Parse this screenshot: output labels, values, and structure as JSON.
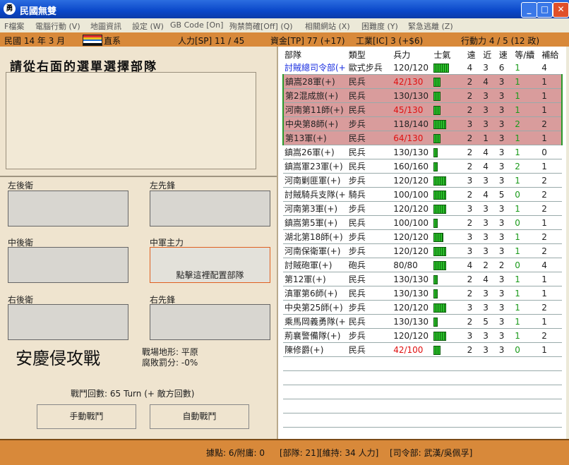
{
  "window": {
    "title": "民國無雙",
    "app_icon": "勇",
    "controls": {
      "minimize": "_",
      "maximize": "□",
      "close": "✕"
    }
  },
  "menu": [
    "F檔案",
    "電腦行動 (V)",
    "地圖資訊",
    "設定 (W)",
    "GB Code [On]",
    "殉禁筒確[Off] (Q)",
    "相關網站 (X)",
    "困難度 (Y)",
    "緊急逃離 (Z)"
  ],
  "status": {
    "date": "民國 14 年 3 月",
    "faction": "直系",
    "manpower": "人力[SP] 11 / 45",
    "money": "資金[TP] 77 (+17)",
    "industry": "工業[IC] 3 (+$6)",
    "action": "行動力 4 / 5 (12 政)",
    "flag_colors": [
      "#e03030",
      "#e8c020",
      "#2070d0",
      "#ffffff",
      "#101010"
    ]
  },
  "left": {
    "header": "請從右面的選單選擇部隊",
    "slots": {
      "left_rear": "左後衛",
      "left_front": "左先鋒",
      "center_rear": "中後衛",
      "center_main": "中軍主力",
      "center_main_hint": "點擊這裡配置部隊",
      "right_rear": "右後衛",
      "right_front": "右先鋒"
    },
    "battle_name": "安慶侵攻戰",
    "terrain": "戰場地形: 平原",
    "penalty": "腐敗罰分: -0%",
    "rounds": "戰鬥回數: 65 Turn (+ 敵方回數)",
    "manual_button": "手動戰鬥",
    "auto_button": "自動戰鬥"
  },
  "table": {
    "headers": [
      "部隊",
      "類型",
      "兵力",
      "士氣",
      "遠",
      "近",
      "速",
      "等/續",
      "補給"
    ],
    "rows": [
      {
        "name": "討賊總司令部(+",
        "type": "歐式步兵",
        "strength": "120/120",
        "morale_bars": 5,
        "far": "4",
        "near": "3",
        "speed": "6",
        "level": "1",
        "supply": "4",
        "hl": false,
        "blue": true,
        "red_strength": false
      },
      {
        "name": "鎮嵩28軍(+)",
        "type": "民兵",
        "strength": "42/130",
        "morale_bars": 2,
        "far": "2",
        "near": "4",
        "speed": "3",
        "level": "1",
        "supply": "1",
        "hl": true,
        "blue": false,
        "red_strength": true
      },
      {
        "name": "第2混成旅(+)",
        "type": "民兵",
        "strength": "130/130",
        "morale_bars": 2,
        "far": "2",
        "near": "3",
        "speed": "3",
        "level": "1",
        "supply": "1",
        "hl": true,
        "blue": false,
        "red_strength": false
      },
      {
        "name": "河南第11師(+)",
        "type": "民兵",
        "strength": "45/130",
        "morale_bars": 2,
        "far": "2",
        "near": "3",
        "speed": "3",
        "level": "1",
        "supply": "1",
        "hl": true,
        "blue": false,
        "red_strength": true
      },
      {
        "name": "中央第8師(+)",
        "type": "步兵",
        "strength": "118/140",
        "morale_bars": 4,
        "far": "3",
        "near": "3",
        "speed": "3",
        "level": "2",
        "supply": "2",
        "hl": true,
        "blue": false,
        "red_strength": false
      },
      {
        "name": "第13軍(+)",
        "type": "民兵",
        "strength": "64/130",
        "morale_bars": 2,
        "far": "2",
        "near": "1",
        "speed": "3",
        "level": "1",
        "supply": "1",
        "hl": true,
        "blue": false,
        "red_strength": true
      },
      {
        "name": "鎮嵩26軍(+)",
        "type": "民兵",
        "strength": "130/130",
        "morale_bars": 1,
        "far": "2",
        "near": "4",
        "speed": "3",
        "level": "1",
        "supply": "0",
        "hl": false,
        "blue": false,
        "red_strength": false
      },
      {
        "name": "鎮嵩軍23軍(+)",
        "type": "民兵",
        "strength": "160/160",
        "morale_bars": 1,
        "far": "2",
        "near": "4",
        "speed": "3",
        "level": "2",
        "supply": "1",
        "hl": false,
        "blue": false,
        "red_strength": false
      },
      {
        "name": "河南剿匪軍(+)",
        "type": "步兵",
        "strength": "120/120",
        "morale_bars": 4,
        "far": "3",
        "near": "3",
        "speed": "3",
        "level": "1",
        "supply": "2",
        "hl": false,
        "blue": false,
        "red_strength": false
      },
      {
        "name": "討賊騎兵支隊(+",
        "type": "騎兵",
        "strength": "100/100",
        "morale_bars": 4,
        "far": "2",
        "near": "4",
        "speed": "5",
        "level": "0",
        "supply": "2",
        "hl": false,
        "blue": false,
        "red_strength": false
      },
      {
        "name": "河南第3軍(+)",
        "type": "步兵",
        "strength": "120/120",
        "morale_bars": 4,
        "far": "3",
        "near": "3",
        "speed": "3",
        "level": "1",
        "supply": "2",
        "hl": false,
        "blue": false,
        "red_strength": false
      },
      {
        "name": "鎮嵩第5軍(+)",
        "type": "民兵",
        "strength": "100/100",
        "morale_bars": 1,
        "far": "2",
        "near": "3",
        "speed": "3",
        "level": "0",
        "supply": "1",
        "hl": false,
        "blue": false,
        "red_strength": false
      },
      {
        "name": "湖北第18師(+)",
        "type": "步兵",
        "strength": "120/120",
        "morale_bars": 3,
        "far": "3",
        "near": "3",
        "speed": "3",
        "level": "1",
        "supply": "2",
        "hl": false,
        "blue": false,
        "red_strength": false
      },
      {
        "name": "河南保衛軍(+)",
        "type": "步兵",
        "strength": "120/120",
        "morale_bars": 4,
        "far": "3",
        "near": "3",
        "speed": "3",
        "level": "1",
        "supply": "2",
        "hl": false,
        "blue": false,
        "red_strength": false
      },
      {
        "name": "討賊砲軍(+)",
        "type": "砲兵",
        "strength": "80/80",
        "morale_bars": 4,
        "far": "4",
        "near": "2",
        "speed": "2",
        "level": "0",
        "supply": "4",
        "hl": false,
        "blue": false,
        "red_strength": false
      },
      {
        "name": "第12軍(+)",
        "type": "民兵",
        "strength": "130/130",
        "morale_bars": 1,
        "far": "2",
        "near": "4",
        "speed": "3",
        "level": "1",
        "supply": "1",
        "hl": false,
        "blue": false,
        "red_strength": false
      },
      {
        "name": "滇軍第6師(+)",
        "type": "民兵",
        "strength": "130/130",
        "morale_bars": 1,
        "far": "2",
        "near": "3",
        "speed": "3",
        "level": "1",
        "supply": "1",
        "hl": false,
        "blue": false,
        "red_strength": false
      },
      {
        "name": "中央第25師(+)",
        "type": "步兵",
        "strength": "120/120",
        "morale_bars": 4,
        "far": "3",
        "near": "3",
        "speed": "3",
        "level": "1",
        "supply": "2",
        "hl": false,
        "blue": false,
        "red_strength": false
      },
      {
        "name": "乘馬岡義勇隊(+",
        "type": "民兵",
        "strength": "130/130",
        "morale_bars": 1,
        "far": "2",
        "near": "5",
        "speed": "3",
        "level": "1",
        "supply": "1",
        "hl": false,
        "blue": false,
        "red_strength": false
      },
      {
        "name": "荊襄警備隊(+)",
        "type": "步兵",
        "strength": "120/120",
        "morale_bars": 4,
        "far": "3",
        "near": "3",
        "speed": "3",
        "level": "1",
        "supply": "2",
        "hl": false,
        "blue": false,
        "red_strength": false
      },
      {
        "name": "陳修爵(+)",
        "type": "民兵",
        "strength": "42/100",
        "morale_bars": 2,
        "far": "2",
        "near": "3",
        "speed": "3",
        "level": "0",
        "supply": "1",
        "hl": false,
        "blue": false,
        "red_strength": true
      }
    ]
  },
  "bottom": {
    "points": "據點: 6/附庸: 0",
    "units": "[部隊: 21]",
    "upkeep": "[維持: 34 人力]",
    "commander": "[司令部: 武漢/吳佩孚]"
  }
}
